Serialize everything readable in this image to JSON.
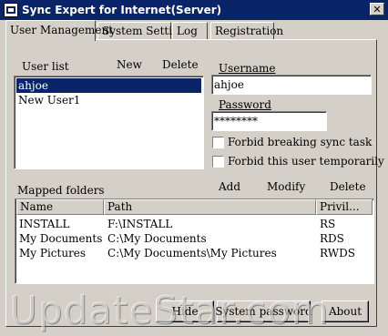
{
  "window": {
    "title": "Sync Expert for Internet(Server)",
    "close_glyph": "✕"
  },
  "tabs": [
    "User Management",
    "System Setting",
    "Log",
    "Registration"
  ],
  "users": {
    "list_label": "User list",
    "new_label": "New",
    "delete_label": "Delete",
    "items": [
      "ahjoe",
      "New User1"
    ],
    "selected_index": 0
  },
  "form": {
    "username_label": "Username",
    "username_value": "ahjoe",
    "password_label": "Password",
    "password_value": "********",
    "forbid_sync_label": "Forbid breaking sync task",
    "forbid_user_label": "Forbid this user temporarily"
  },
  "mapped": {
    "label": "Mapped folders",
    "add_label": "Add",
    "modify_label": "Modify",
    "delete_label": "Delete",
    "columns": [
      "Name",
      "Path",
      "Privil..."
    ],
    "rows": [
      {
        "name": "INSTALL",
        "path": "F:\\INSTALL",
        "priv": "RS"
      },
      {
        "name": "My Documents",
        "path": "C:\\My Documents",
        "priv": "RDS"
      },
      {
        "name": "My Pictures",
        "path": "C:\\My Documents\\My Pictures",
        "priv": "RWDS"
      }
    ]
  },
  "buttons": {
    "hide": "Hide",
    "system_password": "System password",
    "about": "About"
  },
  "watermark": "UpdateStar.com"
}
